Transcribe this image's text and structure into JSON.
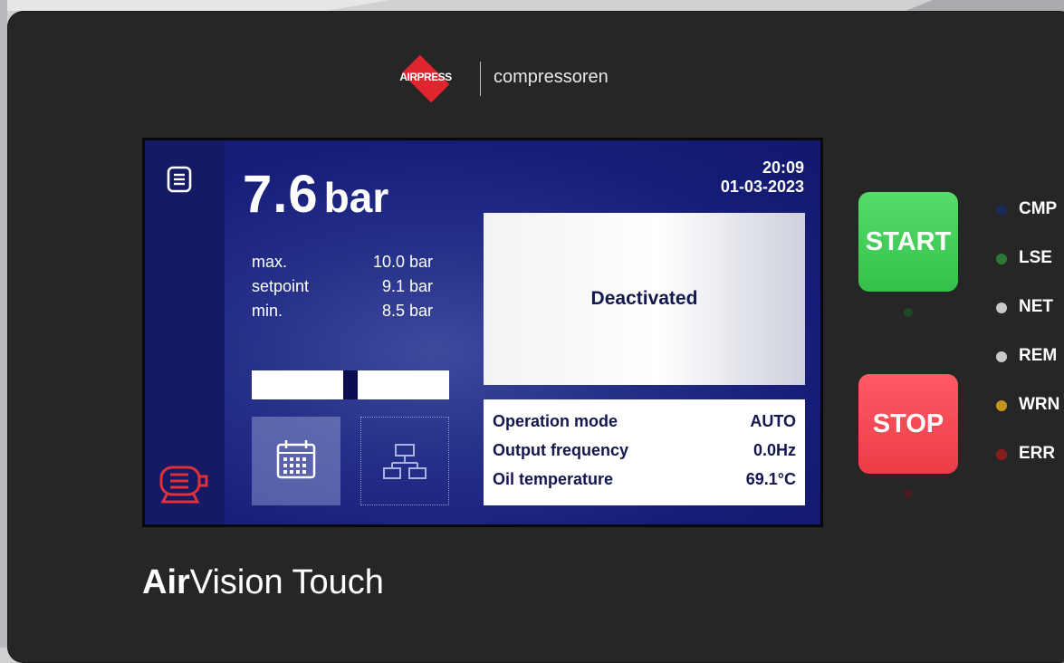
{
  "brand": {
    "logo_text": "AIRPRESS",
    "name": "compressoren"
  },
  "screen": {
    "pressure_value": "7.6",
    "pressure_unit": "bar",
    "stats": [
      {
        "label": "max.",
        "value": "10.0 bar"
      },
      {
        "label": "setpoint",
        "value": "9.1 bar"
      },
      {
        "label": "min.",
        "value": "8.5 bar"
      }
    ],
    "time": "20:09",
    "date": "01-03-2023",
    "status": "Deactivated",
    "info": [
      {
        "label": "Operation mode",
        "value": "AUTO"
      },
      {
        "label": "Output frequency",
        "value": "0.0Hz"
      },
      {
        "label": "Oil temperature",
        "value": "69.1°C"
      }
    ]
  },
  "buttons": {
    "start": "START",
    "stop": "STOP"
  },
  "indicators": [
    {
      "label": "CMP",
      "color": "#1b2a5a"
    },
    {
      "label": "LSE",
      "color": "#2c7a35"
    },
    {
      "label": "NET",
      "color": "#c9c9c9"
    },
    {
      "label": "REM",
      "color": "#c9c9c9"
    },
    {
      "label": "WRN",
      "color": "#c8951c"
    },
    {
      "label": "ERR",
      "color": "#8a1c1c"
    }
  ],
  "product": {
    "bold": "Air",
    "rest": "Vision Touch"
  },
  "icons": [
    "menu-icon",
    "motor-icon",
    "calendar-icon",
    "network-icon"
  ]
}
